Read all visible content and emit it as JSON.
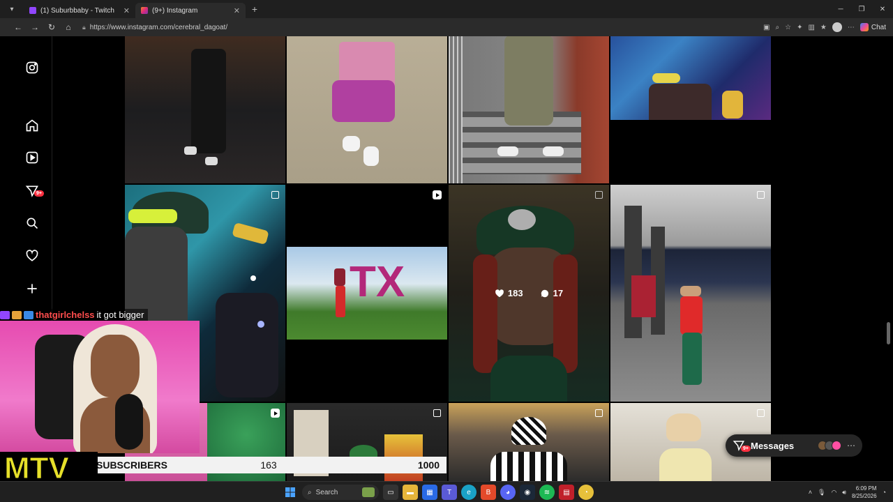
{
  "browser": {
    "tabs": [
      {
        "title": "(1) Suburbbaby - Twitch",
        "favicon_color": "#9146ff"
      },
      {
        "title": "(9+) Instagram",
        "favicon_color": "#e1306c"
      }
    ],
    "url": "https://www.instagram.com/cerebral_dagoat/",
    "chat_label": "Chat"
  },
  "sidebar": {
    "notification_badge": "9+"
  },
  "grid": {
    "hovered_post": {
      "likes": "183",
      "comments": "17"
    }
  },
  "messages": {
    "label": "Messages",
    "badge": "9+"
  },
  "stream": {
    "chat": {
      "username": "thatgirlchelss",
      "message": "it got bigger"
    },
    "subbar": {
      "label": "SUBSCRIBERS",
      "current": "163",
      "goal": "1000"
    },
    "logo_text": "MTV"
  },
  "taskbar": {
    "search_placeholder": "Search",
    "time": "6:09 PM",
    "date": "8/25/2026"
  }
}
